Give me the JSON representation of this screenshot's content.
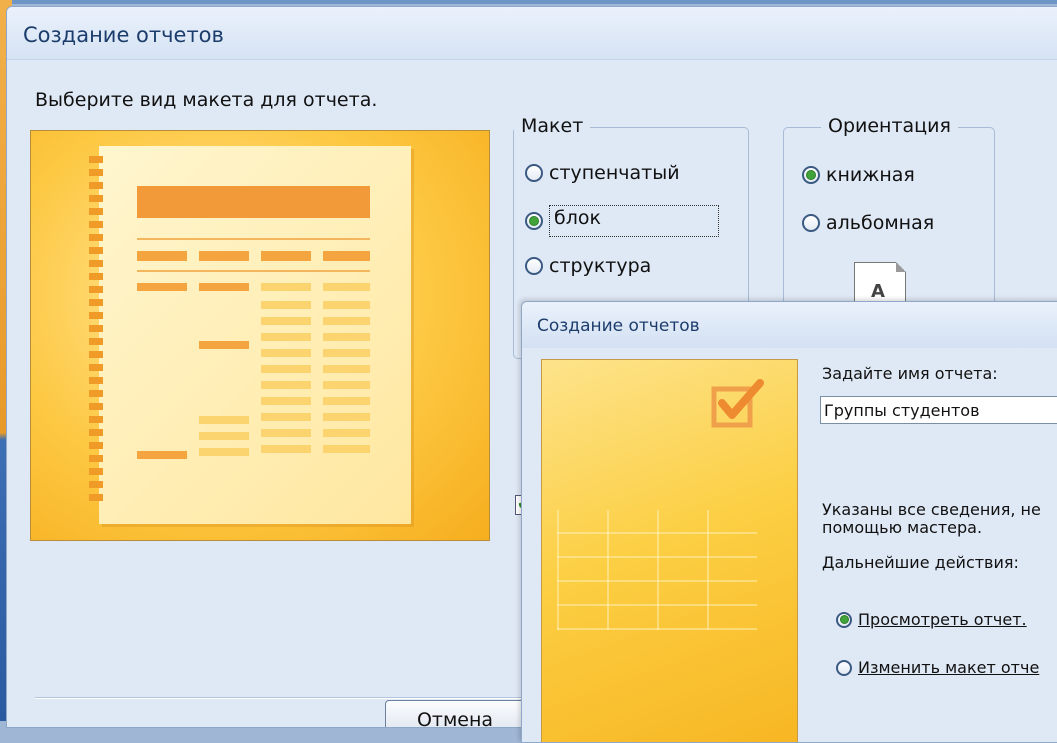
{
  "wizard1": {
    "title": "Создание отчетов",
    "prompt": "Выберите вид макета для отчета.",
    "layout_group": {
      "title": "Макет",
      "options": [
        {
          "label": "ступенчатый",
          "selected": false
        },
        {
          "label": "блок",
          "selected": true
        },
        {
          "label": "структура",
          "selected": false
        }
      ]
    },
    "orientation_group": {
      "title": "Ориентация",
      "options": [
        {
          "label": "книжная",
          "selected": true
        },
        {
          "label": "альбомная",
          "selected": false
        }
      ],
      "icon_letter": "A"
    },
    "cancel_button": "Отмена"
  },
  "wizard2": {
    "title": "Создание отчетов",
    "name_label": "Задайте имя отчета:",
    "name_value": "Группы студентов",
    "info_line1": "Указаны все сведения, не",
    "info_line2": "помощью мастера.",
    "next_actions_label": "Дальнейшие действия:",
    "options": [
      {
        "label": "Просмотреть отчет.",
        "selected": true
      },
      {
        "label": "Изменить макет отче",
        "selected": false
      }
    ]
  },
  "colors": {
    "dialog_bg": "#dfe8f5",
    "title_text": "#1c3d6c",
    "radio_selected": "#41a43a",
    "preview_yellow": "#fccf44"
  }
}
